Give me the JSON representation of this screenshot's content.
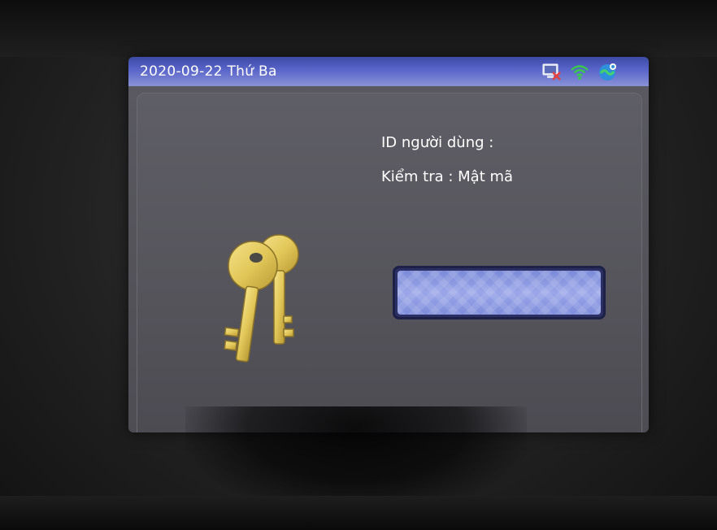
{
  "status_bar": {
    "date_day": "2020-09-22  Thứ Ba",
    "icons": [
      "network-alert-icon",
      "wifi-icon",
      "cloud-sync-icon"
    ]
  },
  "verification": {
    "user_id_label": "ID người dùng :",
    "verify_label": "Kiểm tra : Mật mã",
    "password_value": ""
  },
  "main_icon": "keys-icon",
  "colors": {
    "status_bar": "#5a66c9",
    "panel": "#56555c",
    "password_field": "#8a97df",
    "key_gold": "#e2c759"
  }
}
